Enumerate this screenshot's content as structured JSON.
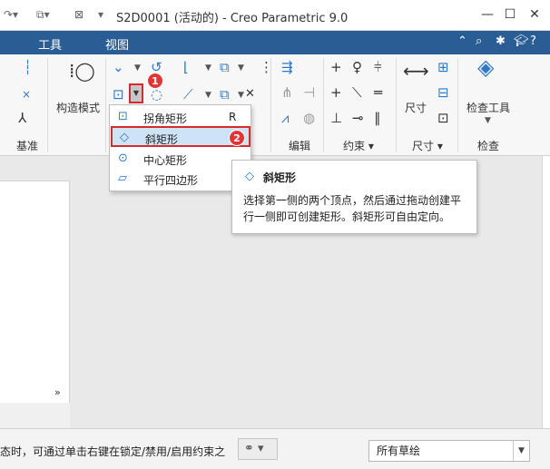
{
  "window": {
    "title": "S2D0001 (活动的) - Creo Parametric 9.0"
  },
  "menubar": {
    "items": [
      "工具",
      "视图"
    ]
  },
  "ribbon": {
    "datum_group": "基准",
    "construction_mode": "构造模式",
    "edit_group": "编辑",
    "constrain_group": "约束",
    "dimension_group": "尺寸",
    "dimension_button": "尺寸",
    "inspect_group": "检查",
    "inspect_tools": "检查工具"
  },
  "dropdown": {
    "items": [
      {
        "label": "拐角矩形",
        "shortcut": "R",
        "icon": "corner-rectangle-icon"
      },
      {
        "label": "斜矩形",
        "shortcut": "",
        "icon": "slanted-rectangle-icon"
      },
      {
        "label": "中心矩形",
        "shortcut": "",
        "icon": "center-rectangle-icon"
      },
      {
        "label": "平行四边形",
        "shortcut": "",
        "icon": "parallelogram-icon"
      }
    ],
    "active_index": 1
  },
  "tooltip": {
    "title": "斜矩形",
    "body": "选择第一侧的两个顶点，然后通过拖动创建平行一侧即可创建矩形。斜矩形可自由定向。"
  },
  "badges": [
    "1",
    "2"
  ],
  "statusbar": {
    "message": "态时，可通过单击右键在锁定/禁用/启用约束之",
    "filter_value": "所有草绘"
  },
  "colors": {
    "menubar": "#2a5d94",
    "accent": "#2f78c9",
    "highlight": "#d62b2b",
    "selected_bg": "#cfe3f6"
  }
}
